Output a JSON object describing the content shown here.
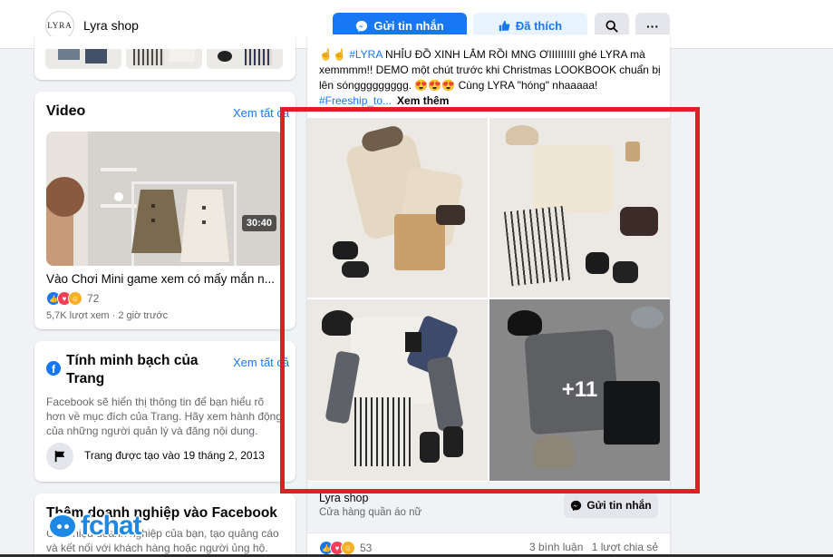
{
  "header": {
    "logo_text": "LYRA",
    "page_name": "Lyra shop",
    "send_message_label": "Gửi tin nhắn",
    "liked_label": "Đã thích",
    "more_label": "···",
    "search_icon": "search-icon",
    "accent_color": "#1877f2"
  },
  "video_card": {
    "title": "Video",
    "see_all": "Xem tất cả",
    "duration": "30:40",
    "video_title": "Vào Chơi Mini game xem có mấy mắn n...",
    "reaction_count": "72",
    "meta": "5,7K lượt xem · 2 giờ trước"
  },
  "transparency_card": {
    "title": "Tính minh bạch của Trang",
    "see_all": "Xem tất cả",
    "description": "Facebook sẽ hiển thị thông tin để bạn hiểu rõ hơn về mục đích của Trang. Hãy xem hành động của những người quản lý và đăng nội dung.",
    "created": "Trang được tạo vào 19 tháng 2, 2013"
  },
  "business_card": {
    "title": "Thêm doanh nghiệp vào Facebook",
    "description": "Giới thiệu doanh nghiệp của bạn, tạo quảng cáo và kết nối với khách hàng hoặc người ủng hộ."
  },
  "watermark": {
    "text": "fchat"
  },
  "post": {
    "text_emoji": "☝☝ ",
    "hashtag_lyra": "#LYRA",
    "text_body": " NHỈU ĐỒ XINH LẮM RỒI MNG ƠIIIIIIIII ghé LYRA mà xemmmm!! DEMO một chút trước khi Christmas LOOKBOOK chuẩn bị lên sónggggggggg. 😍😍😍 Cùng LYRA \"hóng\" nhaaaaa!",
    "hashtag_freeship": "#Freeship_to...",
    "see_more": "Xem thêm",
    "more_photos": "+11",
    "page_link_name": "Lyra shop",
    "page_link_category": "Cửa hàng quần áo nữ",
    "page_message_label": "Gửi tin nhắn",
    "reaction_count": "53",
    "comments": "3 bình luận",
    "shares": "1 lượt chia sẻ",
    "highlight_color": "#e01e26"
  }
}
